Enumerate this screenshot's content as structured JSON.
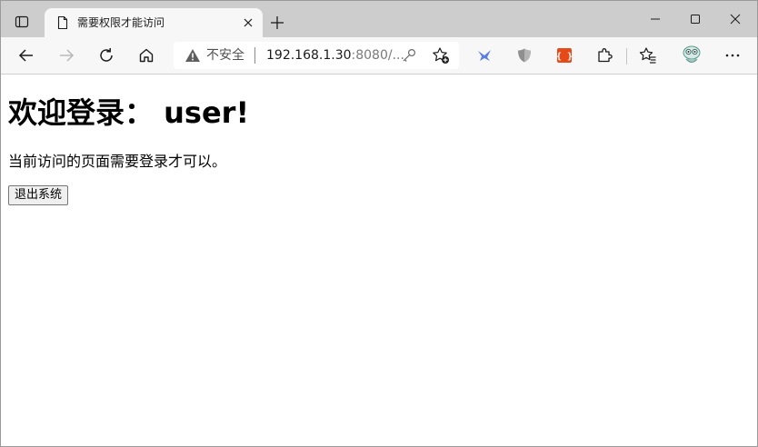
{
  "browser": {
    "tab": {
      "title": "需要权限才能访问"
    },
    "address_bar": {
      "security_label": "不安全",
      "url_host": "192.168.1.30",
      "url_rest": ":8080/..."
    },
    "icons": {
      "tab_actions": "tab-actions-icon",
      "favicon": "page-icon",
      "tab_close": "close-icon",
      "new_tab": "plus-icon",
      "minimize": "minimize-icon",
      "maximize": "maximize-icon",
      "close_window": "close-icon",
      "back": "arrow-left-icon",
      "forward": "arrow-right-icon",
      "refresh": "refresh-icon",
      "home": "home-icon",
      "warning": "warning-icon",
      "key": "key-icon",
      "add_favorite": "star-plus-icon",
      "extensions": "puzzle-icon",
      "favorites": "favorites-icon",
      "profile": "avatar-icon",
      "more": "more-icon"
    },
    "colors": {
      "titlebar": "#cdcdcd",
      "toolbar": "#f7f7f7",
      "extension_red": "#e64a19",
      "extension_blue": "#5b7fe0"
    }
  },
  "page": {
    "heading": "欢迎登录： user!",
    "message": "当前访问的页面需要登录才可以。",
    "logout_button": "退出系统"
  }
}
